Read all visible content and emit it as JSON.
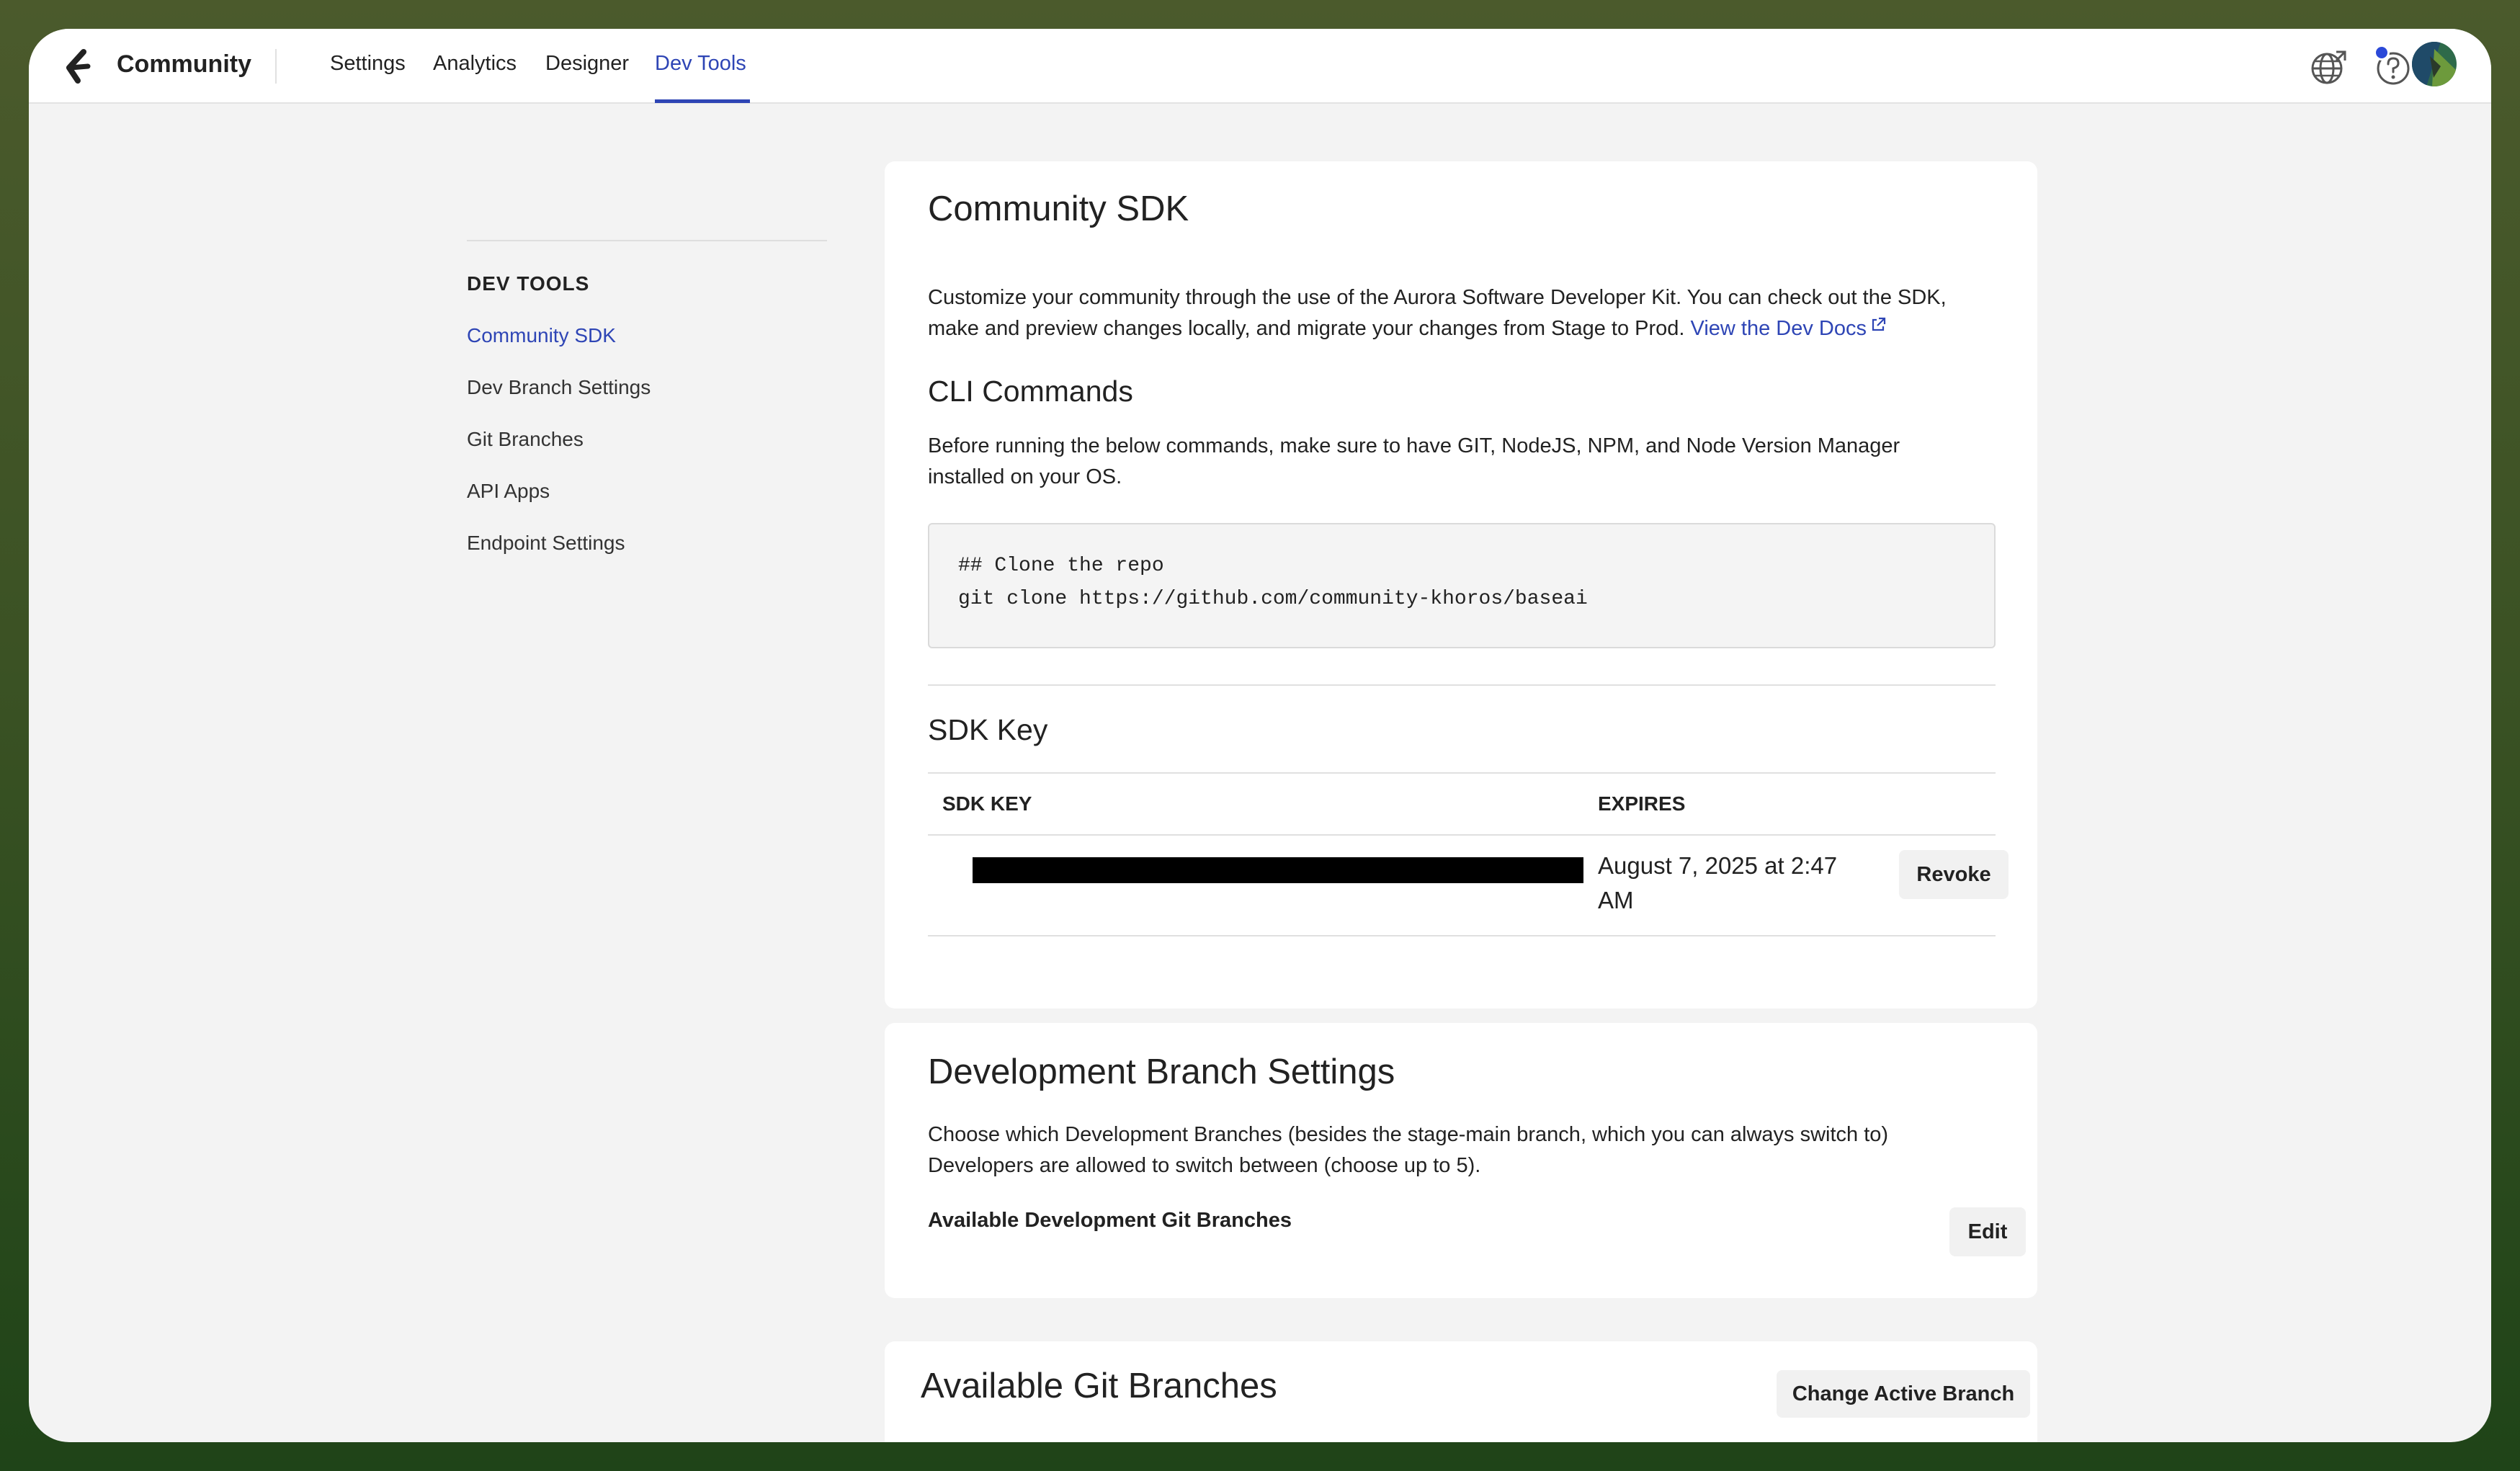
{
  "topbar": {
    "brand": "Community",
    "nav": [
      {
        "label": "Settings"
      },
      {
        "label": "Analytics"
      },
      {
        "label": "Designer"
      },
      {
        "label": "Dev Tools",
        "active": true
      }
    ],
    "icons": [
      "globe-icon",
      "help-icon",
      "avatar"
    ],
    "accent_color": "#2e45b5"
  },
  "sidebar": {
    "heading": "DEV TOOLS",
    "items": [
      {
        "label": "Community SDK",
        "active": true
      },
      {
        "label": "Dev Branch Settings"
      },
      {
        "label": "Git Branches"
      },
      {
        "label": "API Apps"
      },
      {
        "label": "Endpoint Settings"
      }
    ]
  },
  "sdk_card": {
    "title": "Community SDK",
    "description_line1": "Customize your community through the use of the Aurora Software Developer Kit. You can check out the SDK,",
    "description_line2": "make and preview changes locally, and migrate your changes from Stage to Prod.",
    "dev_docs_link": "View the Dev Docs",
    "cli_heading": "CLI Commands",
    "cli_desc_line1": "Before running the below commands, make sure to have GIT, NodeJS, NPM, and Node Version Manager",
    "cli_desc_line2": "installed on your OS.",
    "code": [
      "## Clone the repo",
      "git clone https://github.com/community-khoros/baseai"
    ],
    "sdk_key_heading": "SDK Key",
    "table": {
      "columns": [
        "SDK KEY",
        "EXPIRES"
      ],
      "rows": [
        {
          "expires_line1": "August 7, 2025 at 2:47",
          "expires_line2": "AM",
          "action": "Revoke"
        }
      ]
    }
  },
  "branch_card": {
    "title": "Development Branch Settings",
    "desc_line1": "Choose which Development Branches (besides the stage-main branch, which you can always switch to)",
    "desc_line2": "Developers are allowed to switch between (choose up to 5).",
    "label": "Available Development Git Branches",
    "edit_button": "Edit"
  },
  "git_card": {
    "title": "Available Git Branches",
    "button": "Change Active Branch"
  }
}
